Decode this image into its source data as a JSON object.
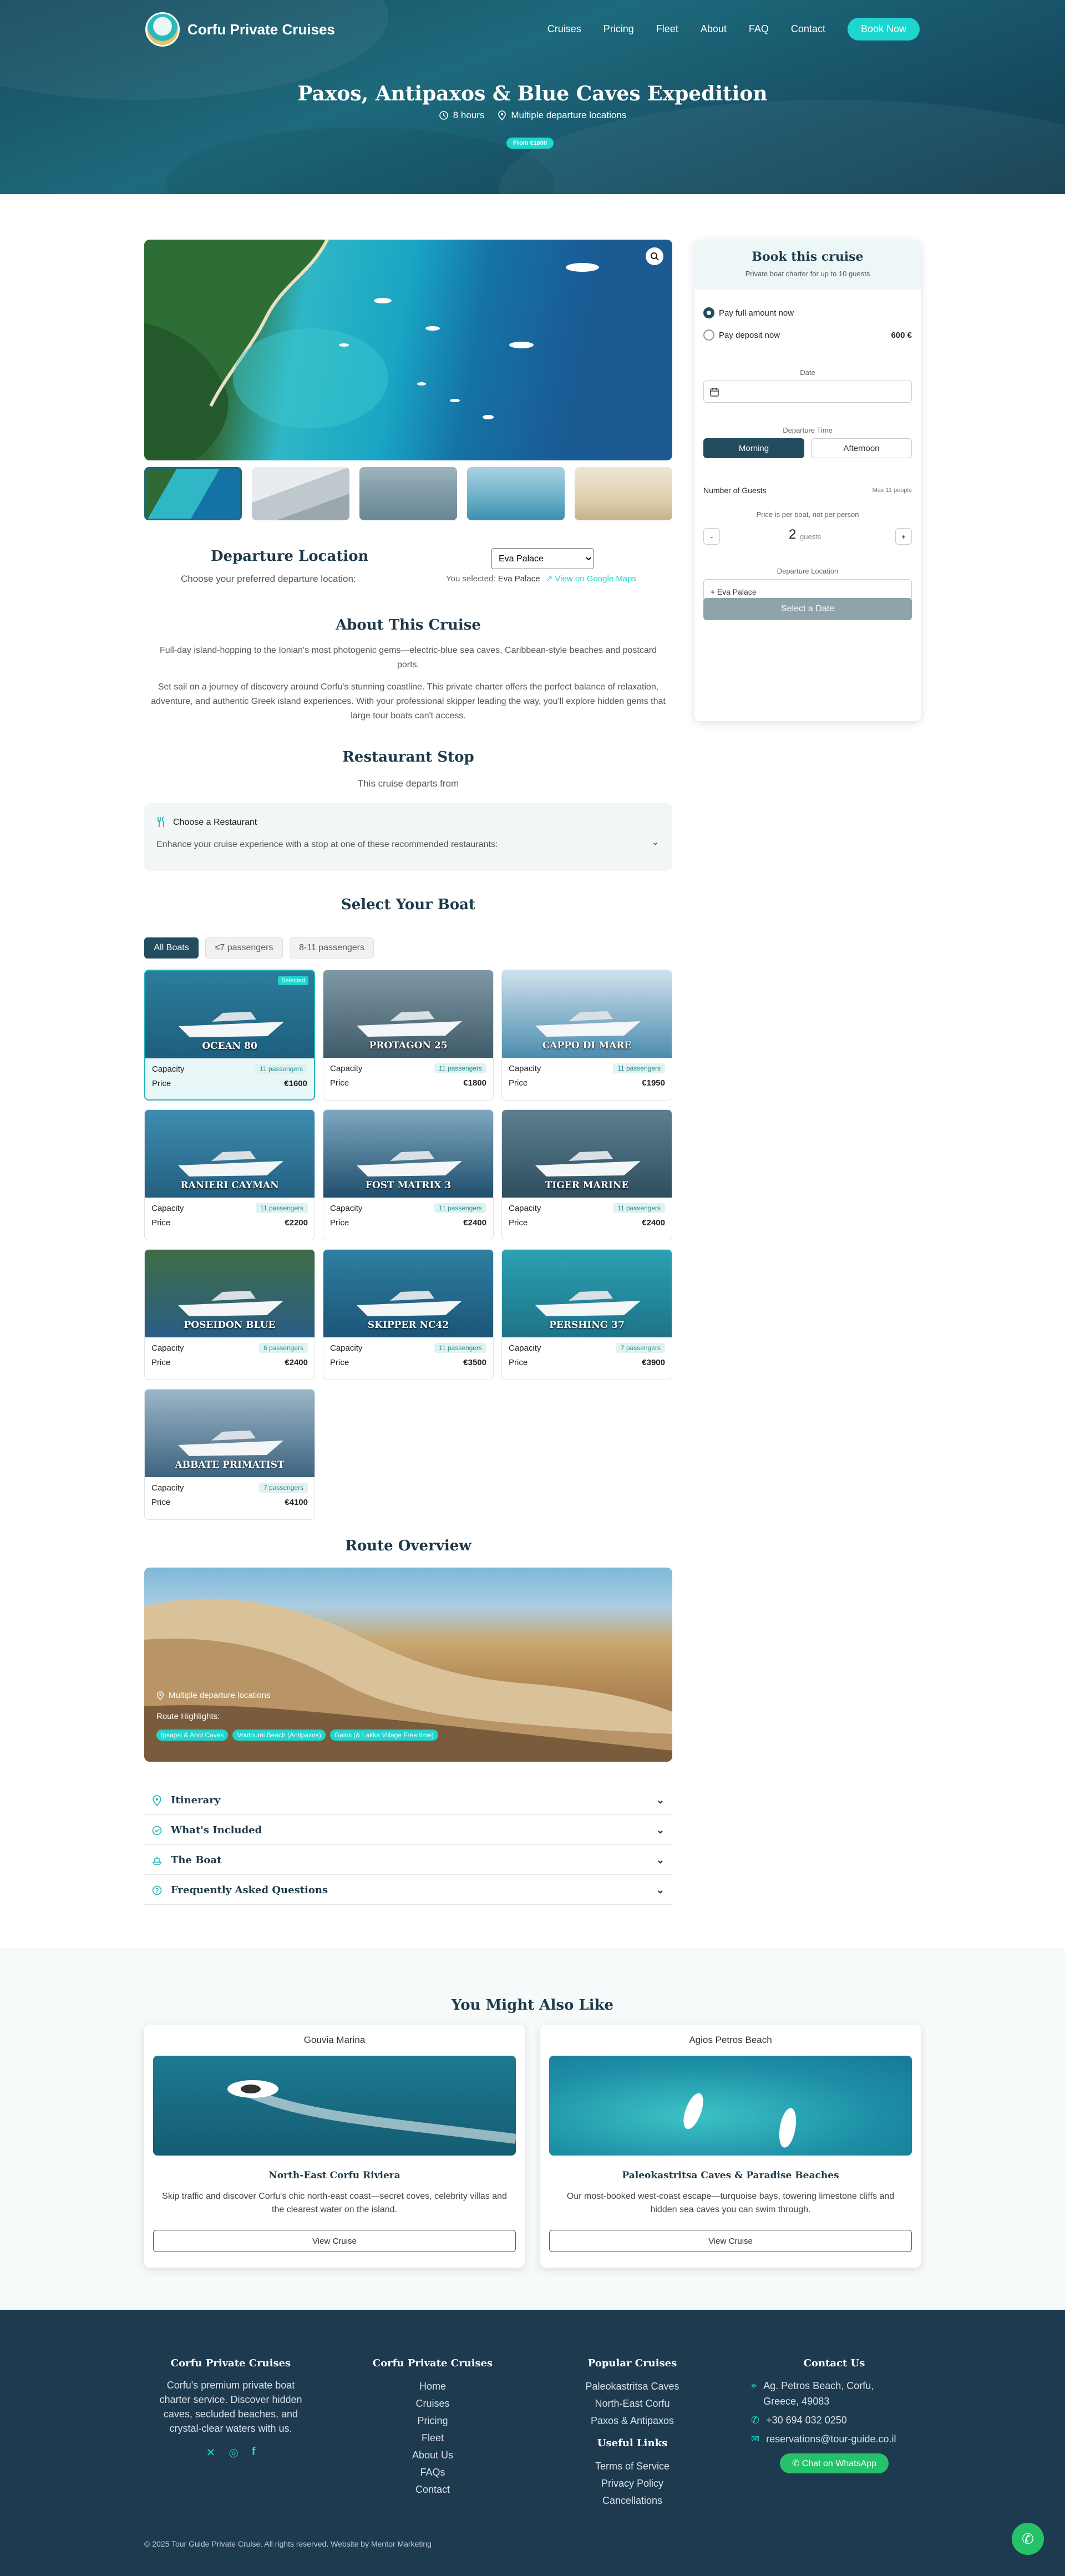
{
  "brand": {
    "name": "Corfu Private Cruises"
  },
  "nav": {
    "items": [
      "Cruises",
      "Pricing",
      "Fleet",
      "About",
      "FAQ",
      "Contact"
    ],
    "cta": "Book Now"
  },
  "hero": {
    "title": "Paxos, Antipaxos & Blue Caves Expedition",
    "duration": "8 hours",
    "locations": "Multiple departure locations",
    "price_badge": "From €1600"
  },
  "departure": {
    "title": "Departure Location",
    "subtitle": "Choose your preferred departure location:",
    "selected_value": "Eva Palace",
    "selected_prefix": "You selected:",
    "selected_name": "Eva Palace",
    "map_link": "View on Google Maps"
  },
  "about": {
    "title": "About This Cruise",
    "p1": "Full-day island-hopping to the Ionian's most photogenic gems—electric-blue sea caves, Caribbean-style beaches and postcard ports.",
    "p2": "Set sail on a journey of discovery around Corfu's stunning coastline. This private charter offers the perfect balance of relaxation, adventure, and authentic Greek island experiences. With your professional skipper leading the way, you'll explore hidden gems that large tour boats can't access."
  },
  "restaurant": {
    "title": "Restaurant Stop",
    "subtitle": "This cruise departs from",
    "box_title": "Choose a Restaurant",
    "box_text": "Enhance your cruise experience with a stop at one of these recommended restaurants:"
  },
  "boats": {
    "title": "Select Your Boat",
    "filters": [
      "All Boats",
      "≤7 passengers",
      "8-11 passengers"
    ],
    "capacity_label": "Capacity",
    "price_label": "Price",
    "selected_badge": "Selected",
    "items": [
      {
        "name": "OCEAN 80",
        "capacity": "11 passengers",
        "price": "€1600"
      },
      {
        "name": "PROTAGON 25",
        "capacity": "11 passengers",
        "price": "€1800"
      },
      {
        "name": "CAPPO DI MARE",
        "capacity": "11 passengers",
        "price": "€1950"
      },
      {
        "name": "RANIERI CAYMAN",
        "capacity": "11 passengers",
        "price": "€2200"
      },
      {
        "name": "FOST MATRIX 3",
        "capacity": "11 passengers",
        "price": "€2400"
      },
      {
        "name": "TIGER MARINE",
        "capacity": "11 passengers",
        "price": "€2400"
      },
      {
        "name": "POSEIDON BLUE",
        "capacity": "6 passengers",
        "price": "€2400"
      },
      {
        "name": "SKIPPER NC42",
        "capacity": "11 passengers",
        "price": "€3500"
      },
      {
        "name": "PERSHING 37",
        "capacity": "7 passengers",
        "price": "€3900"
      },
      {
        "name": "ABBATE PRIMATIST",
        "capacity": "7 passengers",
        "price": "€4100"
      }
    ]
  },
  "route": {
    "title": "Route Overview",
    "location": "Multiple departure locations",
    "highlights_label": "Route Highlights:",
    "highlights": [
      "Ipsapsi & Ahol Caves",
      "Voutoumi Beach (Antipaxos)",
      "Gaios (& Lakka Village Free time)"
    ]
  },
  "accordion": [
    "Itinerary",
    "What's Included",
    "The Boat",
    "Frequently Asked Questions"
  ],
  "booking": {
    "title": "Book this cruise",
    "subtitle": "Private boat charter for up to 10 guests",
    "pay_full": "Pay full amount now",
    "pay_deposit": "Pay deposit now",
    "deposit_amount": "600 €",
    "date_label": "Date",
    "time_label": "Departure Time",
    "morning": "Morning",
    "afternoon": "Afternoon",
    "guests_label": "Number of Guests",
    "guests_max": "Max 11 people",
    "guests_note": "Price is per boat, not per person",
    "guests_value": "2",
    "guests_unit": "guests",
    "dep_label": "Departure Location",
    "dep_value": "Eva Palace",
    "submit": "Select a Date",
    "minus": "-",
    "plus": "+"
  },
  "suggestions": {
    "title": "You Might Also Like",
    "items": [
      {
        "location": "Gouvia Marina",
        "title": "North-East Corfu Riviera",
        "text": "Skip traffic and discover Corfu's chic north-east coast—secret coves, celebrity villas and the clearest water on the island.",
        "button": "View Cruise"
      },
      {
        "location": "Agios Petros Beach",
        "title": "Paleokastritsa Caves & Paradise Beaches",
        "text": "Our most-booked west-coast escape—turquoise bays, towering limestone cliffs and hidden sea caves you can swim through.",
        "button": "View Cruise"
      }
    ]
  },
  "footer": {
    "about": {
      "title": "Corfu Private Cruises",
      "text": "Corfu's premium private boat charter service. Discover hidden caves, secluded beaches, and crystal-clear waters with us."
    },
    "links": {
      "title": "Corfu Private Cruises",
      "items": [
        "Home",
        "Cruises",
        "Pricing",
        "Fleet",
        "About Us",
        "FAQs",
        "Contact"
      ]
    },
    "popular": {
      "title": "Popular Cruises",
      "items": [
        "Paleokastritsa Caves",
        "North-East Corfu",
        "Paxos & Antipaxos"
      ]
    },
    "useful": {
      "title": "Useful Links",
      "items": [
        "Terms of Service",
        "Privacy Policy",
        "Cancellations"
      ]
    },
    "contact": {
      "title": "Contact Us",
      "address": "Ag. Petros Beach, Corfu, Greece, 49083",
      "phone": "+30 694 032 0250",
      "email": "reservations@tour-guide.co.il",
      "whatsapp": "Chat on WhatsApp"
    },
    "copyright": "© 2025 Tour Guide Private Cruise. All rights reserved. Website by Mentor Marketing"
  },
  "colors": {
    "accent": "#1fd6cf",
    "navy": "#1e3a4f",
    "teal_dark": "#1d6a7c",
    "button_dark": "#234c5f"
  }
}
